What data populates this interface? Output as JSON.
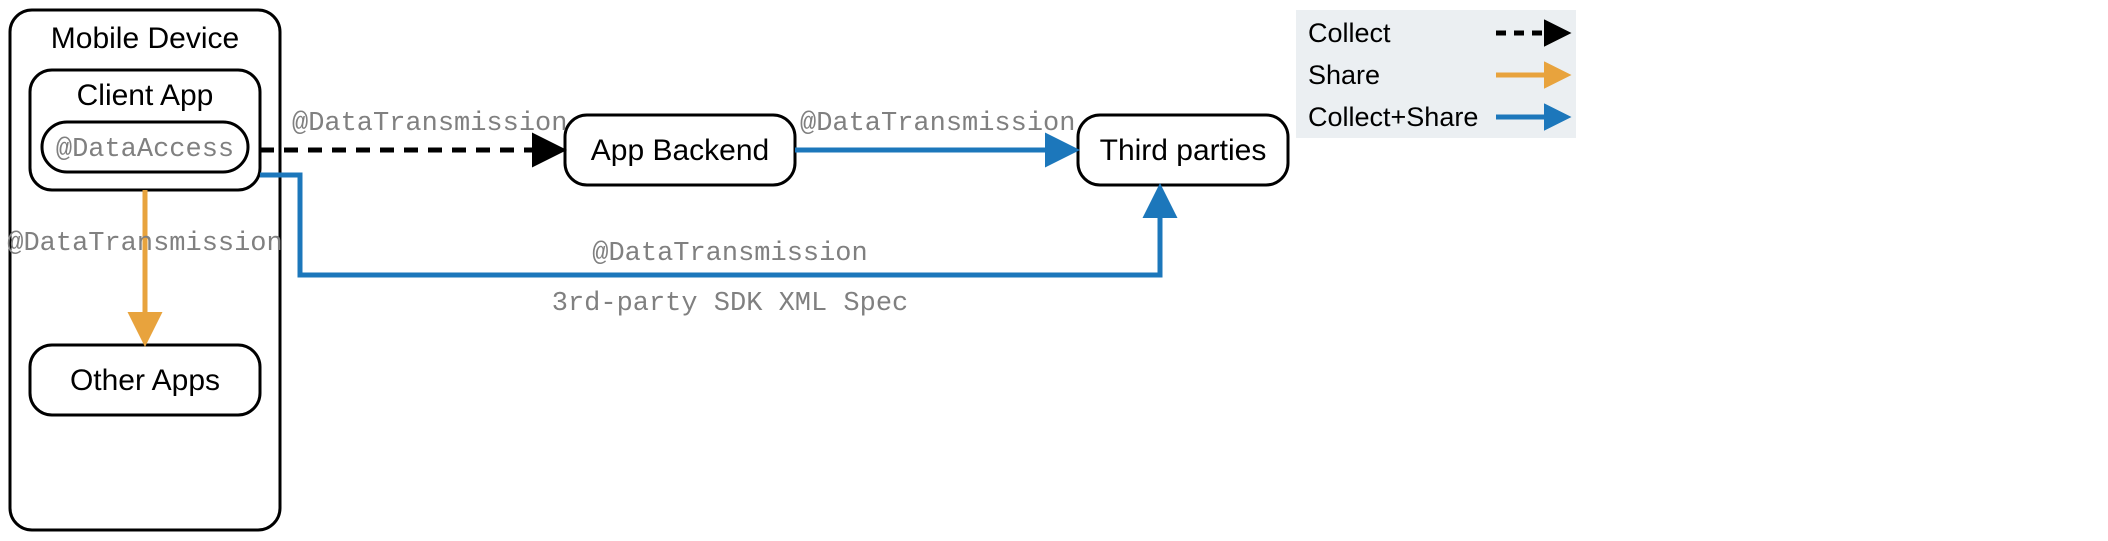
{
  "nodes": {
    "mobile_device": "Mobile Device",
    "client_app": "Client App",
    "data_access": "@DataAccess",
    "other_apps": "Other Apps",
    "app_backend": "App Backend",
    "third_parties": "Third parties"
  },
  "edges": {
    "client_to_backend_label": "@DataTransmission",
    "client_to_other_label": "@DataTransmission",
    "backend_to_third_label": "@DataTransmission",
    "client_to_third_label_top": "@DataTransmission",
    "client_to_third_label_bottom": "3rd-party SDK XML Spec"
  },
  "legend": {
    "collect": "Collect",
    "share": "Share",
    "collect_share": "Collect+Share"
  },
  "colors": {
    "collect": "#000000",
    "share": "#e8a33d",
    "collect_share": "#1c77bb"
  }
}
